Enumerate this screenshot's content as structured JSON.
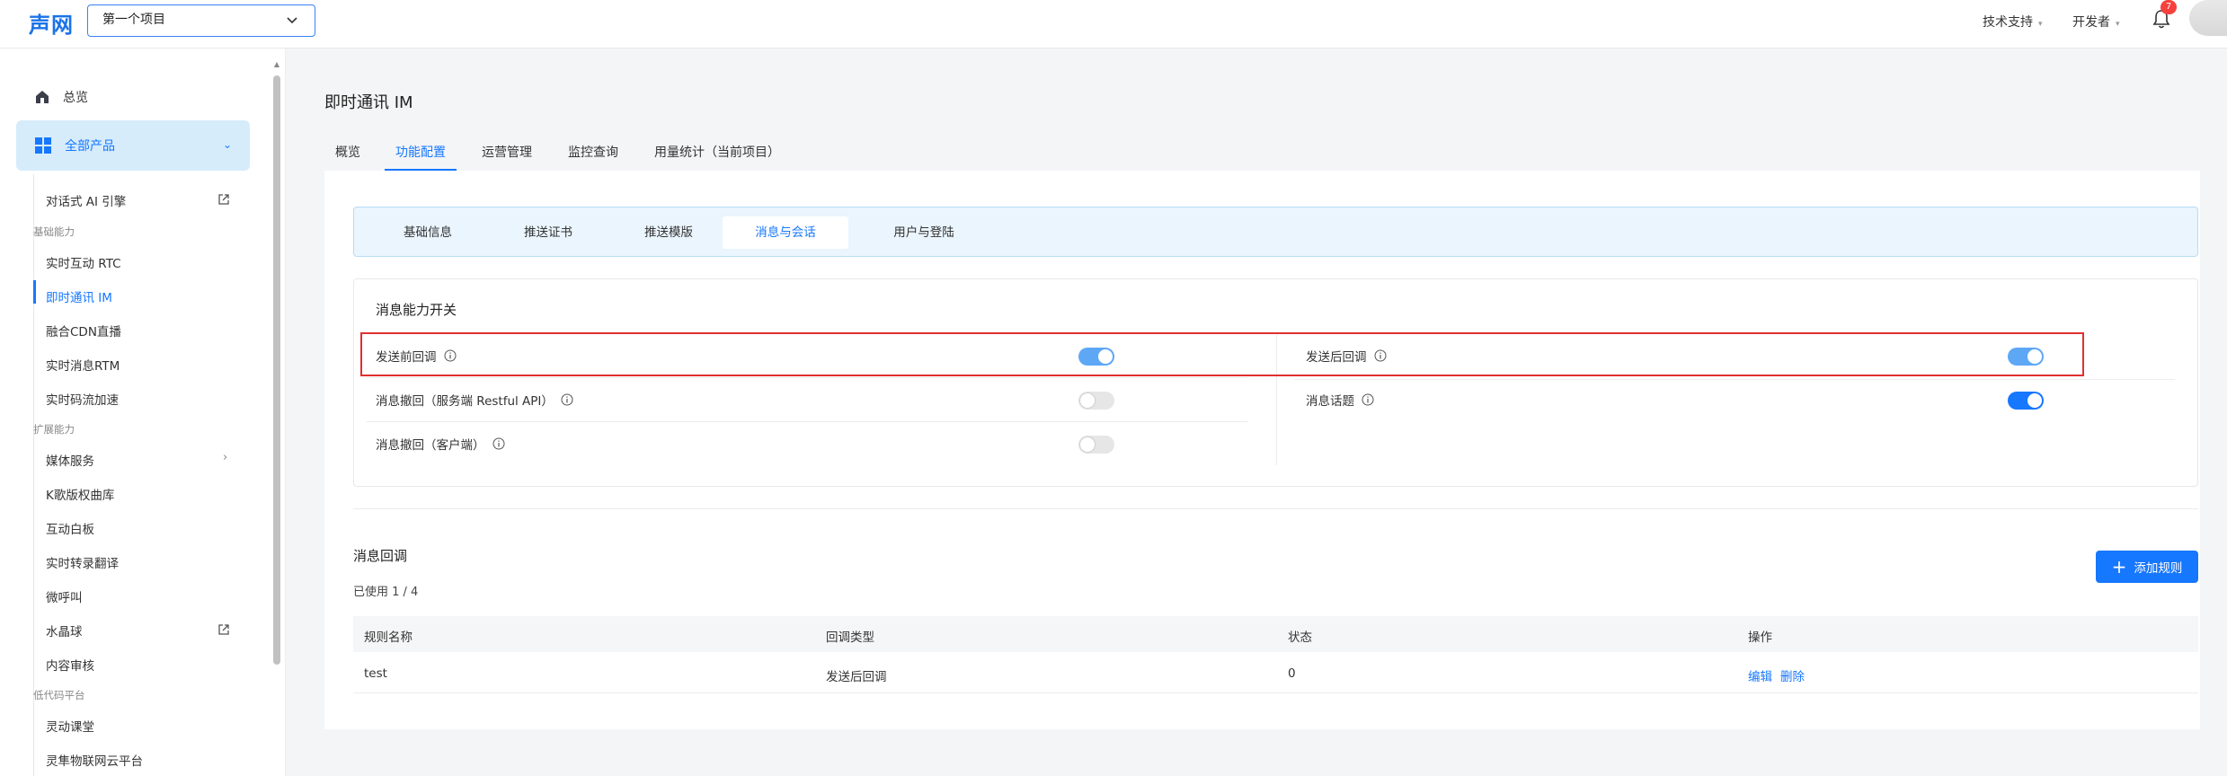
{
  "topbar": {
    "logo": "声网",
    "project_select": "第一个项目",
    "tech_support": "技术支持",
    "developer": "开发者",
    "notification_count": "7"
  },
  "sidebar": {
    "overview": "总览",
    "all_products": "全部产品",
    "items": [
      {
        "label": "对话式 AI 引擎",
        "external": true
      },
      {
        "group": "基础能力"
      },
      {
        "label": "实时互动 RTC"
      },
      {
        "label": "即时通讯 IM",
        "active": true
      },
      {
        "label": "融合CDN直播"
      },
      {
        "label": "实时消息RTM"
      },
      {
        "label": "实时码流加速"
      },
      {
        "group": "扩展能力"
      },
      {
        "label": "媒体服务",
        "submenu": true
      },
      {
        "label": "K歌版权曲库"
      },
      {
        "label": "互动白板"
      },
      {
        "label": "实时转录翻译"
      },
      {
        "label": "微呼叫"
      },
      {
        "label": "水晶球",
        "external": true
      },
      {
        "label": "内容审核"
      },
      {
        "group": "低代码平台"
      },
      {
        "label": "灵动课堂"
      },
      {
        "label": "灵隼物联网云平台"
      }
    ]
  },
  "page": {
    "title": "即时通讯 IM",
    "tabs": [
      "概览",
      "功能配置",
      "运营管理",
      "监控查询",
      "用量统计（当前项目）"
    ],
    "active_tab": "功能配置",
    "subtabs": [
      "基础信息",
      "推送证书",
      "推送模版",
      "消息与会话",
      "用户与登陆"
    ],
    "active_subtab": "消息与会话"
  },
  "switch_card": {
    "title": "消息能力开关",
    "left": [
      {
        "label": "发送前回调",
        "on": true
      },
      {
        "label": "消息撤回（服务端 Restful API）",
        "on": false
      },
      {
        "label": "消息撤回（客户端）",
        "on": false
      }
    ],
    "right": [
      {
        "label": "发送后回调",
        "on": true
      },
      {
        "label": "消息话题",
        "on": true
      }
    ]
  },
  "callback": {
    "title": "消息回调",
    "usage": "已使用 1 / 4",
    "add_button": "添加规则",
    "columns": [
      "规则名称",
      "回调类型",
      "状态",
      "操作"
    ],
    "rows": [
      {
        "name": "test",
        "type": "发送后回调",
        "status": "0",
        "edit": "编辑",
        "delete": "删除"
      }
    ]
  },
  "colors": {
    "primary": "#1677ff",
    "highlight": "#e03030",
    "subtab_bg": "#eaf5fd"
  }
}
